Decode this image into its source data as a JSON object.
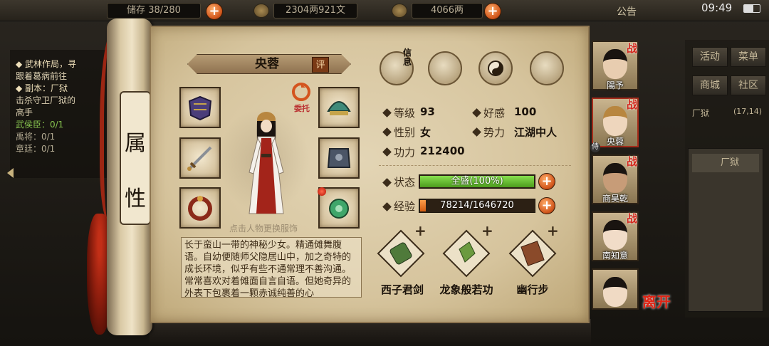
{
  "status_bar": {
    "time": "09:49"
  },
  "resources": {
    "capacity": "38/280",
    "capacity_prefix": "储存",
    "money": "2304两921文",
    "gold": "4066两",
    "notice": "公告"
  },
  "quest": {
    "line1": "◆ 武林作局，寻",
    "line2": "跟着葛病前往",
    "line3": "◆ 副本：厂狱",
    "line4": "击杀守卫厂狱的",
    "line5": "高手",
    "line6": "武侯臣：0/1",
    "line7": "禹将：0/1",
    "line8": "章廷：0/1"
  },
  "right_panel": {
    "buttons": [
      "活动",
      "菜单",
      "商城",
      "社区"
    ],
    "location": "厂狱",
    "coords": "(17,14)",
    "map_item": "厂狱"
  },
  "scroll": {
    "title_chars": [
      "属",
      "性"
    ]
  },
  "character": {
    "name": "央蓉",
    "eval_label": "评",
    "weituo_label": "委托",
    "tip": "点击人物更换服饰",
    "description": "长于蛮山一带的神秘少女。精通傩舞腹语。自幼便随师父隐居山中，加之奇特的成长环境，似乎有些不通常理不善沟通。常常喜欢对着傩面自言自语。但她奇异的外表下包裹着一颗赤诚纯善的心"
  },
  "top_icons": {
    "xinwu_label": "信息"
  },
  "stats": {
    "level_label": "等级",
    "level": "93",
    "favor_label": "好感",
    "favor": "100",
    "gender_label": "性别",
    "gender": "女",
    "faction_label": "势力",
    "faction": "江湖中人",
    "power_label": "功力",
    "power": "212400",
    "state_label": "状态",
    "state_text": "全盛(100%)",
    "state_pct": 100,
    "exp_label": "经验",
    "exp_text": "78214/1646720",
    "exp_pct": 4.75
  },
  "skills": [
    {
      "name": "西子君剑"
    },
    {
      "name": "龙象般若功"
    },
    {
      "name": "幽行步"
    }
  ],
  "portraits": [
    {
      "name": "陽予",
      "tag": "战"
    },
    {
      "name": "央蓉",
      "tag": "战",
      "marker": "侍"
    },
    {
      "name": "商昊乾",
      "tag": "战"
    },
    {
      "name": "南知意",
      "tag": "战"
    },
    {
      "name": "",
      "tag": ""
    }
  ],
  "leave_label": "离开"
}
